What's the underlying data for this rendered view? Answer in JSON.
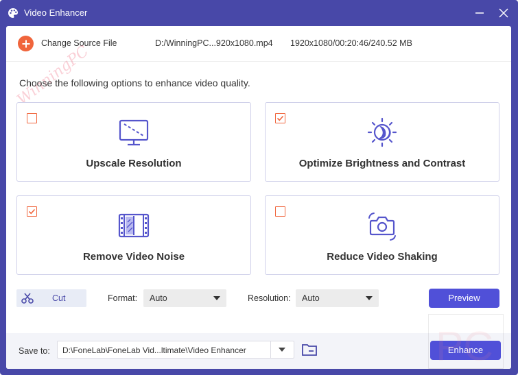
{
  "window": {
    "title": "Video Enhancer"
  },
  "source": {
    "change_label": "Change Source File",
    "file_name": "D:/WinningPC...920x1080.mp4",
    "file_info": "1920x1080/00:20:46/240.52 MB"
  },
  "instruction": "Choose the following options to enhance video quality.",
  "options": [
    {
      "label": "Upscale Resolution",
      "checked": false,
      "icon": "monitor-icon"
    },
    {
      "label": "Optimize Brightness and Contrast",
      "checked": true,
      "icon": "brightness-icon"
    },
    {
      "label": "Remove Video Noise",
      "checked": true,
      "icon": "film-icon"
    },
    {
      "label": "Reduce Video Shaking",
      "checked": false,
      "icon": "camera-shake-icon"
    }
  ],
  "toolbar": {
    "cut_label": "Cut",
    "format_label": "Format:",
    "format_value": "Auto",
    "resolution_label": "Resolution:",
    "resolution_value": "Auto",
    "preview_label": "Preview"
  },
  "save": {
    "label": "Save to:",
    "path": "D:\\FoneLab\\FoneLab Vid...ltimate\\Video Enhancer",
    "enhance_label": "Enhance"
  },
  "watermark": {
    "text": "WinningPC",
    "logo_text": "PC"
  },
  "colors": {
    "frame": "#4848a8",
    "accent": "#5050d8",
    "checkbox": "#f0653c",
    "icon": "#5555cc"
  }
}
